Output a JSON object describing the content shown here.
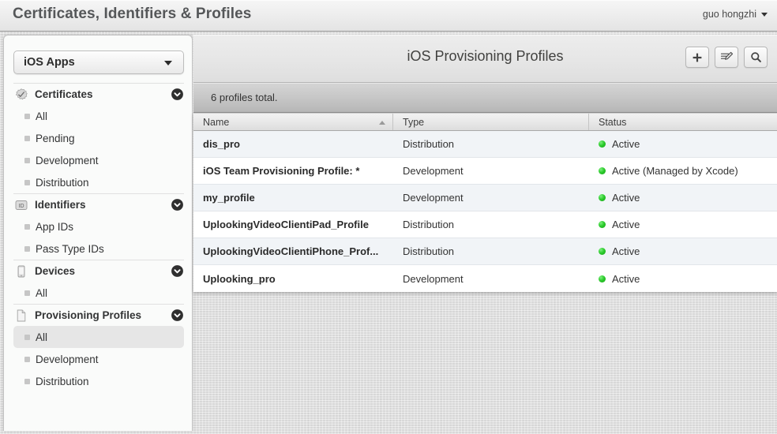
{
  "header": {
    "app_title": "Certificates, Identifiers & Profiles",
    "user_name": "guo hongzhi"
  },
  "sidebar": {
    "team_select": {
      "value": "iOS Apps",
      "icon": "chevron-down-icon"
    },
    "groups": [
      {
        "title": "Certificates",
        "icon": "certificate-seal-icon",
        "collapse_icon": "chevron-down-circle-icon",
        "items": [
          {
            "label": "All",
            "selected": false
          },
          {
            "label": "Pending",
            "selected": false
          },
          {
            "label": "Development",
            "selected": false
          },
          {
            "label": "Distribution",
            "selected": false
          }
        ]
      },
      {
        "title": "Identifiers",
        "icon": "id-badge-icon",
        "collapse_icon": "chevron-down-circle-icon",
        "items": [
          {
            "label": "App IDs",
            "selected": false
          },
          {
            "label": "Pass Type IDs",
            "selected": false
          }
        ]
      },
      {
        "title": "Devices",
        "icon": "phone-icon",
        "collapse_icon": "chevron-down-circle-icon",
        "items": [
          {
            "label": "All",
            "selected": false
          }
        ]
      },
      {
        "title": "Provisioning Profiles",
        "icon": "document-icon",
        "collapse_icon": "chevron-down-circle-icon",
        "items": [
          {
            "label": "All",
            "selected": true
          },
          {
            "label": "Development",
            "selected": false
          },
          {
            "label": "Distribution",
            "selected": false
          }
        ]
      }
    ]
  },
  "main": {
    "title": "iOS Provisioning Profiles",
    "toolbar": [
      {
        "name": "add-profile-button",
        "icon": "plus-icon"
      },
      {
        "name": "edit-profile-button",
        "icon": "edit-pencil-icon"
      },
      {
        "name": "search-button",
        "icon": "search-icon"
      }
    ],
    "summary": "6 profiles total.",
    "table": {
      "columns": [
        {
          "label": "Name",
          "sort": "asc"
        },
        {
          "label": "Type",
          "sort": null
        },
        {
          "label": "Status",
          "sort": null
        }
      ],
      "rows": [
        {
          "name": "dis_pro",
          "type": "Distribution",
          "status": "Active"
        },
        {
          "name": "iOS Team Provisioning Profile: *",
          "type": "Development",
          "status": "Active (Managed by Xcode)"
        },
        {
          "name": "my_profile",
          "type": "Development",
          "status": "Active"
        },
        {
          "name": "UplookingVideoClientiPad_Profile",
          "type": "Distribution",
          "status": "Active"
        },
        {
          "name": "UplookingVideoClientiPhone_Prof...",
          "type": "Distribution",
          "status": "Active"
        },
        {
          "name": "Uplooking_pro",
          "type": "Development",
          "status": "Active"
        }
      ]
    }
  },
  "colors": {
    "status_active": "#2ecc2e",
    "page_background": "#dddddd",
    "panel_background": "#fafbfa",
    "row_alt": "#f1f4f7"
  }
}
